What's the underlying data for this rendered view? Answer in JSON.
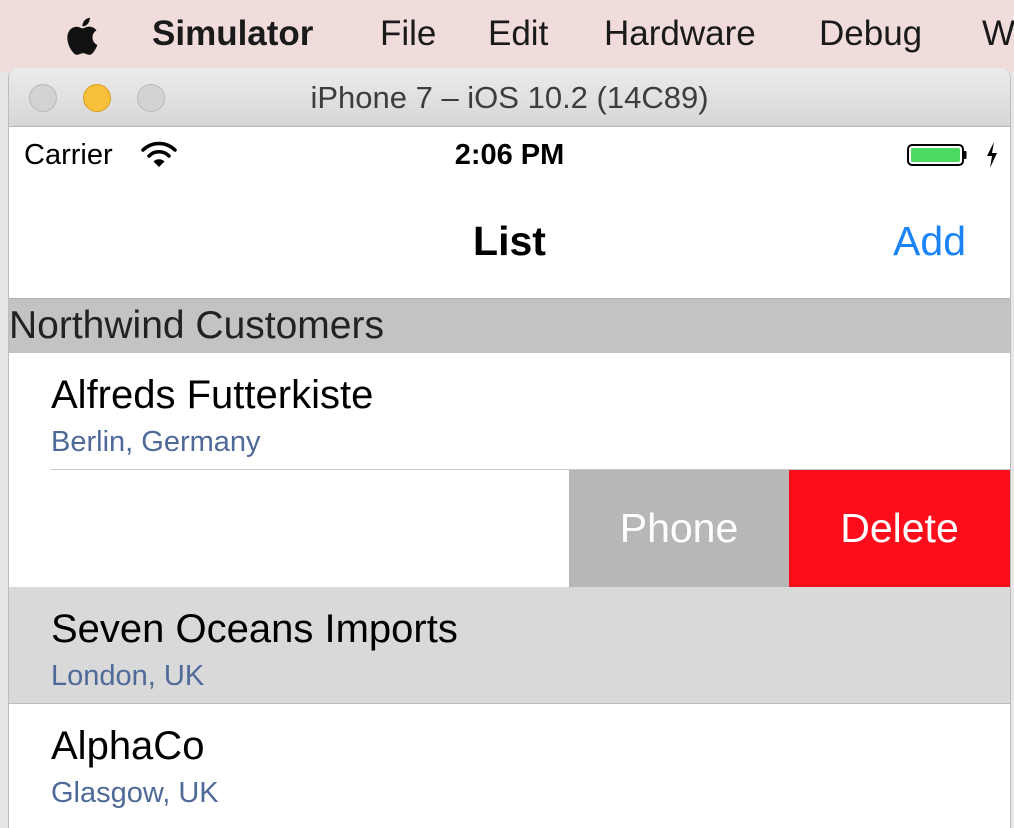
{
  "mac_menu": {
    "items": [
      "Simulator",
      "File",
      "Edit",
      "Hardware",
      "Debug",
      "W"
    ]
  },
  "window": {
    "title": "iPhone 7 – iOS 10.2 (14C89)"
  },
  "status_bar": {
    "carrier": "Carrier",
    "time": "2:06 PM"
  },
  "nav_bar": {
    "title": "List",
    "add_label": "Add"
  },
  "section": {
    "header": "Northwind Customers"
  },
  "customers": [
    {
      "name": "Alfreds Futterkiste",
      "location": "Berlin, Germany"
    },
    {
      "name": "Seven Oceans Imports",
      "location": "London, UK"
    },
    {
      "name": "AlphaCo",
      "location": "Glasgow, UK"
    }
  ],
  "swipe_actions": {
    "phone_label": "Phone",
    "delete_label": "Delete"
  },
  "colors": {
    "accent": "#1a84f7",
    "delete": "#fb0d1b",
    "phone_action": "#b7b7b7",
    "subtitle": "#4f6a98",
    "section_header": "#c3c3c3",
    "battery": "#4cd964"
  },
  "icons": [
    "apple-icon",
    "wifi-icon",
    "battery-icon",
    "charging-bolt-icon"
  ]
}
